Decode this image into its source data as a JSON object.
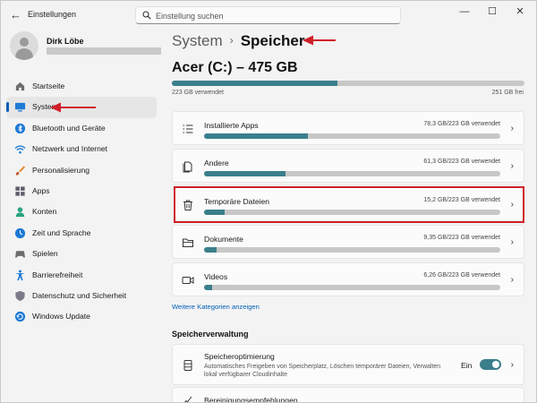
{
  "window": {
    "title": "Einstellungen",
    "back_glyph": "←",
    "minimize_glyph": "—",
    "maximize_glyph": "☐",
    "close_glyph": "✕"
  },
  "search": {
    "placeholder": "Einstellung suchen"
  },
  "profile": {
    "name": "Dirk Löbe"
  },
  "nav": {
    "items": [
      {
        "label": "Startseite",
        "icon": "home-icon"
      },
      {
        "label": "System",
        "icon": "monitor-icon",
        "active": true
      },
      {
        "label": "Bluetooth und Geräte",
        "icon": "bluetooth-icon"
      },
      {
        "label": "Netzwerk und Internet",
        "icon": "wifi-icon"
      },
      {
        "label": "Personalisierung",
        "icon": "brush-icon"
      },
      {
        "label": "Apps",
        "icon": "apps-icon"
      },
      {
        "label": "Konten",
        "icon": "account-icon"
      },
      {
        "label": "Zeit und Sprache",
        "icon": "globe-clock-icon"
      },
      {
        "label": "Spielen",
        "icon": "gamepad-icon"
      },
      {
        "label": "Barrierefreiheit",
        "icon": "accessibility-icon"
      },
      {
        "label": "Datenschutz und Sicherheit",
        "icon": "shield-icon"
      },
      {
        "label": "Windows Update",
        "icon": "update-icon"
      }
    ]
  },
  "breadcrumb": {
    "parent": "System",
    "separator": "›",
    "current": "Speicher"
  },
  "drive": {
    "title": "Acer (C:) – 475 GB",
    "used_label": "223 GB verwendet",
    "free_label": "251 GB frei",
    "used_fraction": 0.47
  },
  "categories": [
    {
      "label": "Installierte Apps",
      "value": "78,3 GB/223 GB verwendet",
      "fraction": 0.351,
      "icon": "list-icon"
    },
    {
      "label": "Andere",
      "value": "61,3 GB/223 GB verwendet",
      "fraction": 0.275,
      "icon": "document-icon"
    },
    {
      "label": "Temporäre Dateien",
      "value": "15,2 GB/223 GB verwendet",
      "fraction": 0.068,
      "icon": "trash-icon",
      "highlighted": true
    },
    {
      "label": "Dokumente",
      "value": "9,35 GB/223 GB verwendet",
      "fraction": 0.042,
      "icon": "folder-icon"
    },
    {
      "label": "Videos",
      "value": "6,26 GB/223 GB verwendet",
      "fraction": 0.028,
      "icon": "video-icon"
    }
  ],
  "more_link": "Weitere Kategorien anzeigen",
  "section_title": "Speicherverwaltung",
  "storage_sense": {
    "title": "Speicheroptimierung",
    "description": "Automatisches Freigeben von Speicherplatz, Löschen temporärer Dateien, Verwalten lokal verfügbarer Cloudinhalte",
    "state_label": "Ein",
    "enabled": true
  },
  "cleanup": {
    "title": "Bereinigungsempfehlungen"
  },
  "colors": {
    "accent": "#3b7f8c",
    "annotation": "#d0202a",
    "link": "#005fb8"
  }
}
